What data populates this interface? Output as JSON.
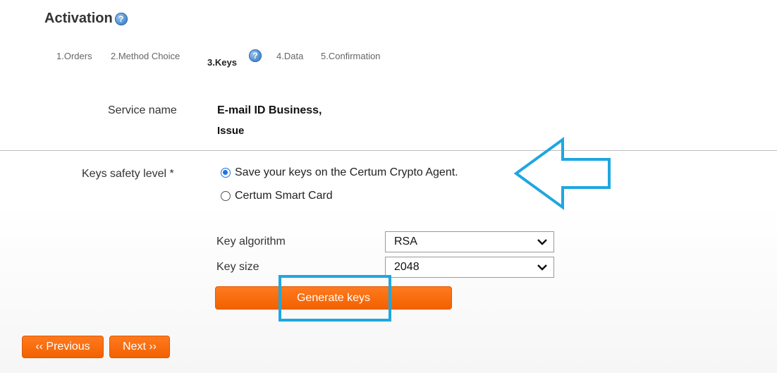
{
  "header": {
    "title": "Activation",
    "help_icon": "?"
  },
  "steps": [
    {
      "label": "1.Orders"
    },
    {
      "label": "2.Method Choice"
    },
    {
      "label": "3.Keys"
    },
    {
      "label": "4.Data"
    },
    {
      "label": "5.Confirmation"
    }
  ],
  "service": {
    "label": "Service name",
    "value_line1": "E-mail ID Business,",
    "value_line2": "Issue"
  },
  "keys_safety": {
    "label": "Keys safety level *",
    "options": [
      {
        "label": "Save your keys on the Certum Crypto Agent.",
        "checked": true
      },
      {
        "label": "Certum Smart Card",
        "checked": false
      }
    ]
  },
  "key_algorithm": {
    "label": "Key algorithm",
    "value": "RSA"
  },
  "key_size": {
    "label": "Key size",
    "value": "2048"
  },
  "buttons": {
    "generate": "Generate keys",
    "previous": "‹‹ Previous",
    "next": "Next ››"
  },
  "colors": {
    "accent": "#f26100",
    "annotation": "#1ea7e0",
    "radio": "#1a73e8"
  }
}
